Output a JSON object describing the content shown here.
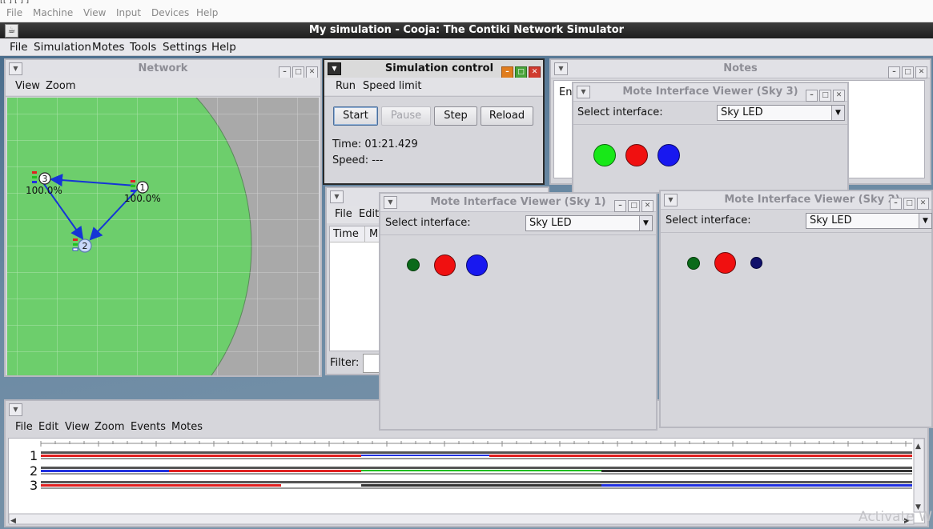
{
  "host_menu": {
    "items": [
      "File",
      "Machine",
      "View",
      "Input",
      "Devices",
      "Help"
    ]
  },
  "title": "My simulation - Cooja: The Contiki Network Simulator",
  "main_menu": [
    "File",
    "Simulation",
    "Motes",
    "Tools",
    "Settings",
    "Help"
  ],
  "network": {
    "title": "Network",
    "menu": [
      "View",
      "Zoom"
    ],
    "motes": [
      {
        "id": "1",
        "label": "100.0%"
      },
      {
        "id": "2",
        "label": ""
      },
      {
        "id": "3",
        "label": "100.0%"
      }
    ],
    "colors": {
      "range": "#6dce6c",
      "outside": "#a9a9a9",
      "link": "#1535d6"
    }
  },
  "sim_control": {
    "title": "Simulation control",
    "menu": [
      "Run",
      "Speed limit"
    ],
    "buttons": {
      "start": "Start",
      "pause": "Pause",
      "step": "Step",
      "reload": "Reload"
    },
    "time_label": "Time:",
    "time": "01:21.429",
    "speed_label": "Speed:",
    "speed": "---"
  },
  "notes": {
    "title": "Notes",
    "text": "En"
  },
  "log": {
    "menu": [
      "File",
      "Edit"
    ],
    "col_time": "Time",
    "col_m": "M",
    "filter_label": "Filter:"
  },
  "viewers": {
    "sky3": {
      "title": "Mote Interface Viewer (Sky 3)",
      "select_label": "Select interface:",
      "selected": "Sky LED",
      "leds": [
        "green",
        "red",
        "blue"
      ]
    },
    "sky1": {
      "title": "Mote Interface Viewer (Sky 1)",
      "select_label": "Select interface:",
      "selected": "Sky LED",
      "leds": [
        "darkgreen-small",
        "red",
        "blue"
      ]
    },
    "sky2": {
      "title": "Mote Interface Viewer (Sky 2)",
      "select_label": "Select interface:",
      "selected": "Sky LED",
      "leds": [
        "darkgreen-small",
        "red",
        "darkblue-small"
      ]
    }
  },
  "timeline": {
    "menu": [
      "File",
      "Edit",
      "View",
      "Zoom",
      "Events",
      "Motes"
    ],
    "rows": [
      "1",
      "2",
      "3"
    ]
  },
  "watermark": "Activate W"
}
